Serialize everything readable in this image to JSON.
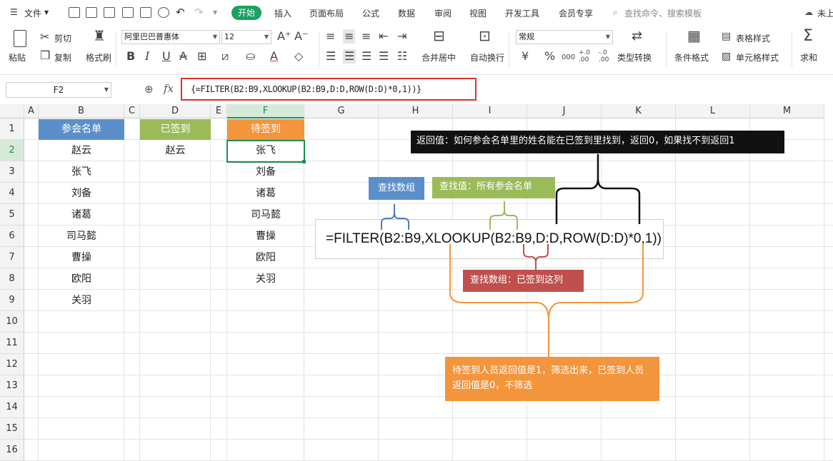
{
  "menu": {
    "file": "文件",
    "tabs": [
      "开始",
      "插入",
      "页面布局",
      "公式",
      "数据",
      "审阅",
      "视图",
      "开发工具",
      "会员专享"
    ],
    "search_placeholder": "查找命令、搜索模板",
    "login": "未上"
  },
  "ribbon": {
    "paste": "粘贴",
    "cut": "剪切",
    "copy": "复制",
    "format_painter": "格式刷",
    "font_name": "阿里巴巴普惠体",
    "font_size": "12",
    "merge_center": "合并居中",
    "wrap_text": "自动换行",
    "number_format": "常规",
    "type_convert": "类型转换",
    "cond_format": "条件格式",
    "table_style": "表格样式",
    "cell_style": "单元格样式",
    "sum": "求和",
    "currency": "¥",
    "percent": "%",
    "thousand": "000",
    "inc_decimal": "+.0 .00",
    "dec_decimal": "-.0 .00"
  },
  "formula_bar": {
    "cell_ref": "F2",
    "fx": "fx",
    "formula": "{=FILTER(B2:B9,XLOOKUP(B2:B9,D:D,ROW(D:D)*0,1))}"
  },
  "sheet": {
    "columns": [
      "A",
      "B",
      "C",
      "D",
      "E",
      "F",
      "G",
      "H",
      "I",
      "J",
      "K",
      "L",
      "M"
    ],
    "rows": [
      "1",
      "2",
      "3",
      "4",
      "5",
      "6",
      "7",
      "8",
      "9",
      "10",
      "11",
      "12",
      "13",
      "14",
      "15",
      "16"
    ],
    "headers": {
      "B": "参会名单",
      "D": "已签到",
      "F": "待签到"
    },
    "col_B": [
      "赵云",
      "张飞",
      "刘备",
      "诸葛",
      "司马懿",
      "曹操",
      "欧阳",
      "关羽"
    ],
    "col_D": [
      "赵云"
    ],
    "col_F": [
      "张飞",
      "刘备",
      "诸葛",
      "司马懿",
      "曹操",
      "欧阳",
      "关羽"
    ]
  },
  "annotations": {
    "big_formula": "=FILTER(B2:B9,XLOOKUP(B2:B9,D:D,ROW(D:D)*0,1))",
    "return_value": "返回值：如何参会名单里的姓名能在已签到里找到，返回0，如果找不到返回1",
    "lookup_array_label": "查找数组",
    "lookup_value_label": "查找值：所有参会名单",
    "lookup_array2_label": "查找数组：已签到这列",
    "result_note": "待签到人员返回值是1，筛选出来，已签到人员返回值是0，不筛选"
  },
  "colors": {
    "accent_green": "#1aa260",
    "header_blue": "#5b8fcb",
    "header_green": "#9bbb59",
    "header_orange": "#f2953d",
    "note_red": "#c0504d",
    "note_black": "#111111"
  }
}
